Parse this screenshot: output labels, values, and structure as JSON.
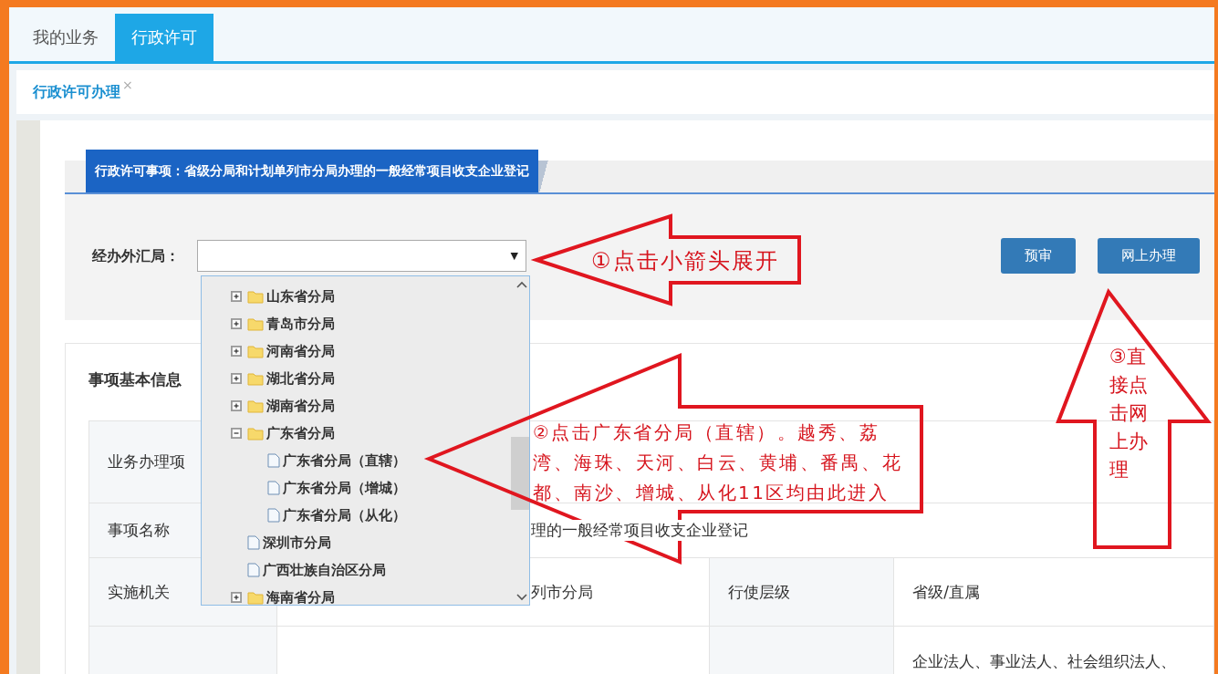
{
  "top_tabs": [
    {
      "label": "我的业务",
      "selected": false
    },
    {
      "label": "行政许可",
      "selected": true
    }
  ],
  "page_tab": {
    "label": "行政许可办理",
    "close": "×"
  },
  "header": {
    "title": "行政许可事项：省级分局和计划单列市分局办理的一般经常项目收支企业登记"
  },
  "form": {
    "label": "经办外汇局：",
    "select_caret": "▼",
    "buttons": [
      "预审",
      "网上办理"
    ]
  },
  "dropdown": {
    "items": [
      {
        "kind": "folder",
        "label": "山东省分局",
        "expanded": false
      },
      {
        "kind": "folder",
        "label": "青岛市分局",
        "expanded": false
      },
      {
        "kind": "folder",
        "label": "河南省分局",
        "expanded": false
      },
      {
        "kind": "folder",
        "label": "湖北省分局",
        "expanded": false
      },
      {
        "kind": "folder",
        "label": "湖南省分局",
        "expanded": false
      },
      {
        "kind": "folder",
        "label": "广东省分局",
        "expanded": true,
        "children": [
          {
            "kind": "file",
            "label": "广东省分局（直辖）"
          },
          {
            "kind": "file",
            "label": "广东省分局（增城）"
          },
          {
            "kind": "file",
            "label": "广东省分局（从化）"
          }
        ]
      },
      {
        "kind": "file",
        "label": "深圳市分局"
      },
      {
        "kind": "file",
        "label": "广西壮族自治区分局"
      },
      {
        "kind": "folder",
        "label": "海南省分局",
        "expanded": false
      }
    ]
  },
  "section": {
    "title": "事项基本信息",
    "rows": [
      [
        {
          "kind": "label",
          "text": "业务办理项"
        },
        {
          "kind": "value",
          "colspan": 3
        }
      ],
      [
        {
          "kind": "label",
          "text": "事项名称"
        },
        {
          "kind": "value",
          "colspan": 3,
          "text": "理的一般经常项目收支企业登记"
        }
      ],
      [
        {
          "kind": "label",
          "text": "实施机关"
        },
        {
          "kind": "value",
          "text": "列市分局"
        },
        {
          "kind": "label",
          "text": "行使层级"
        },
        {
          "kind": "value",
          "text": "省级/直属"
        }
      ],
      [
        {
          "kind": "label"
        },
        {
          "kind": "value"
        },
        {
          "kind": "label"
        },
        {
          "kind": "value",
          "text": "企业法人、事业法人、社会组织法人、"
        }
      ]
    ]
  },
  "annotations": [
    {
      "kind": "left-arrow",
      "text": "①点击小箭头展开"
    },
    {
      "kind": "left-arrow",
      "text": "②点击广东省分局（直辖）。越秀、荔湾、海珠、天河、白云、黄埔、番禺、花都、南沙、增城、从化11区均由此进入"
    },
    {
      "kind": "up-arrow",
      "text": "③直接点击网上办理"
    }
  ]
}
